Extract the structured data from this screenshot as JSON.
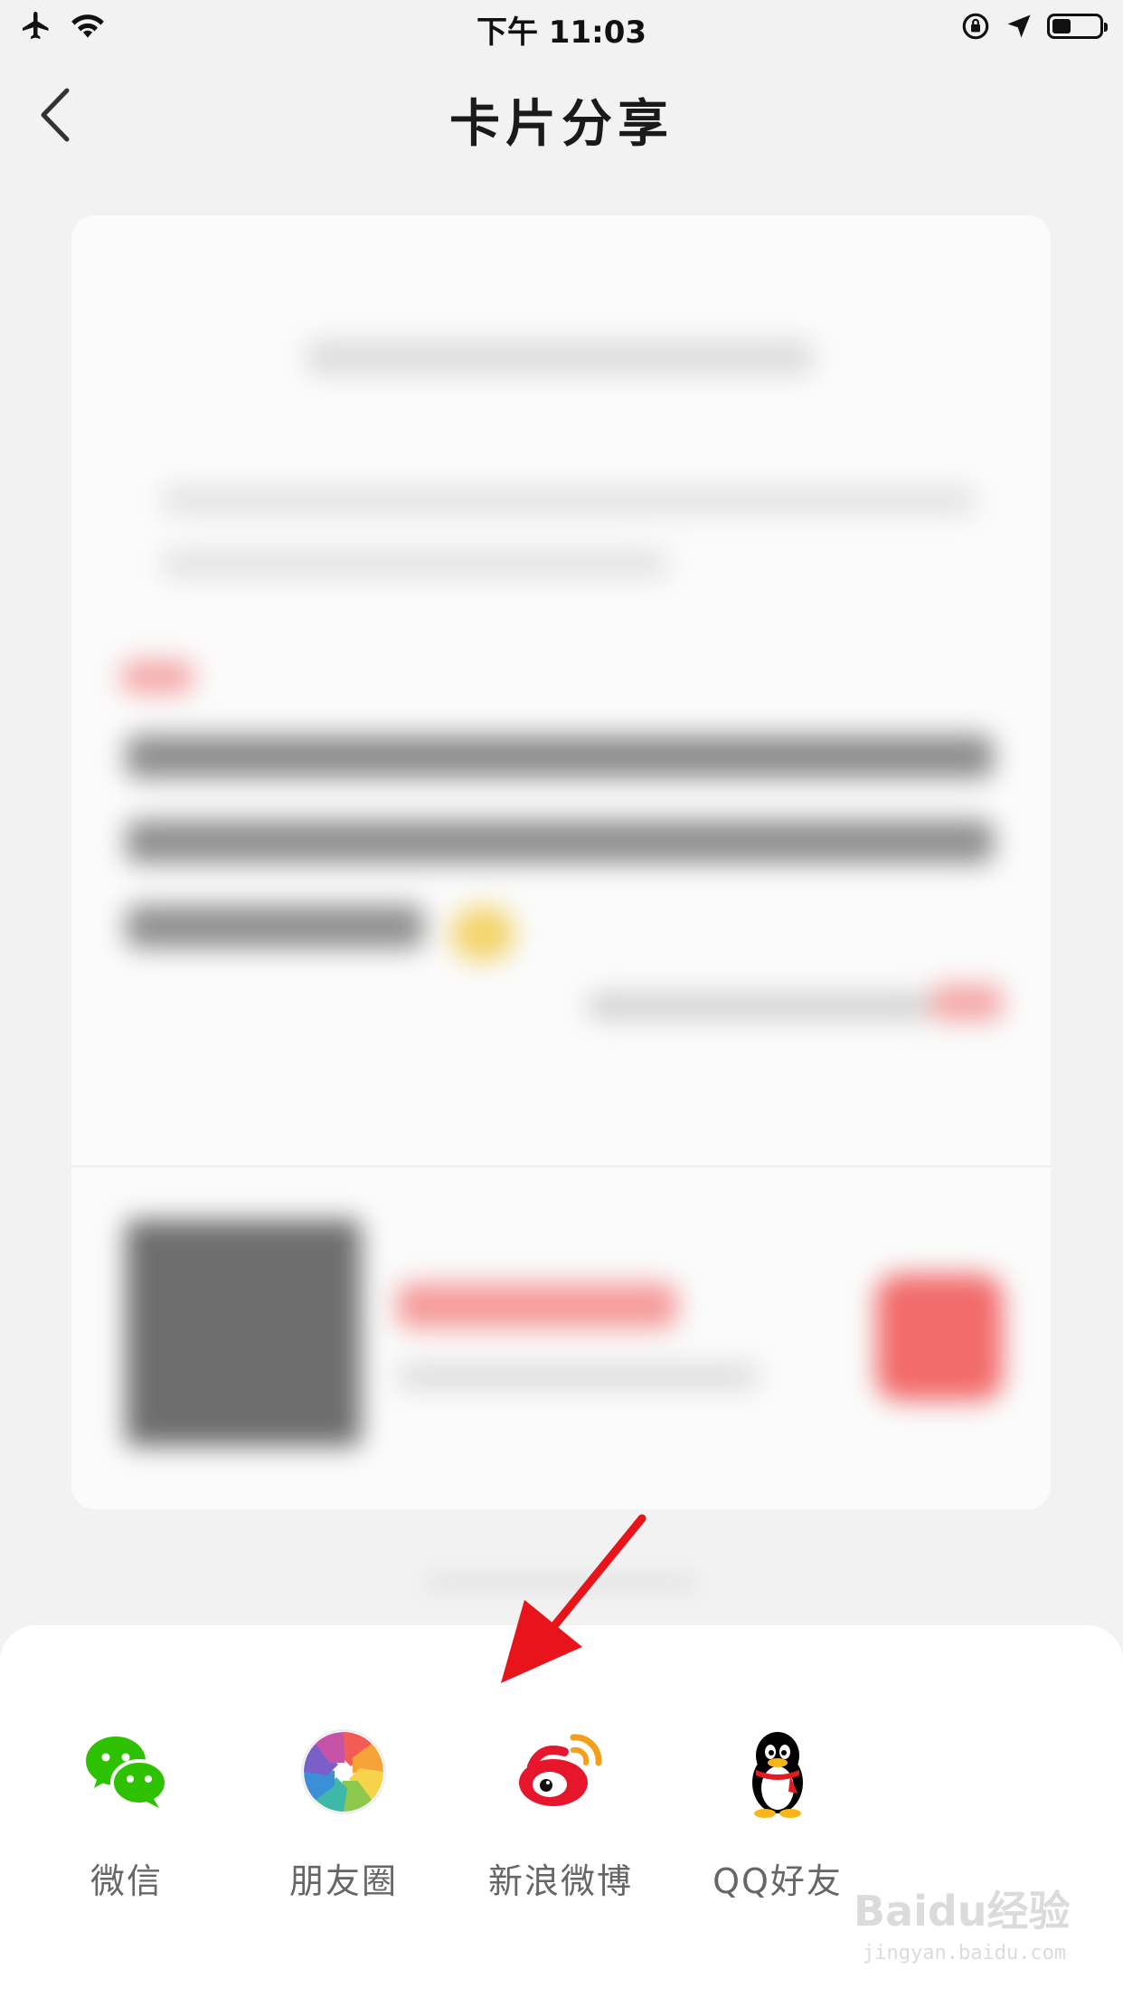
{
  "status_bar": {
    "time": "下午 11:03",
    "battery_level": 0.4,
    "icons": [
      "airplane-icon",
      "wifi-icon",
      "orientation-lock-icon",
      "location-icon",
      "battery-icon"
    ]
  },
  "nav": {
    "title": "卡片分享",
    "back_icon": "chevron-left-icon"
  },
  "share": {
    "items": [
      {
        "label": "微信",
        "icon": "wechat-icon",
        "color": "#2dc100"
      },
      {
        "label": "朋友圈",
        "icon": "moments-icon",
        "color": "#7fc242"
      },
      {
        "label": "新浪微博",
        "icon": "weibo-icon",
        "color": "#e6162d"
      },
      {
        "label": "QQ好友",
        "icon": "qq-icon",
        "color": "#000000"
      }
    ]
  },
  "annotation": {
    "icon": "red-arrow-icon",
    "color": "#e8141b"
  },
  "watermark": {
    "text": "Baidu经验",
    "sub": "jingyan.baidu.com"
  },
  "colors": {
    "accent_red": "#f05a5a",
    "background": "#f2f2f2"
  }
}
